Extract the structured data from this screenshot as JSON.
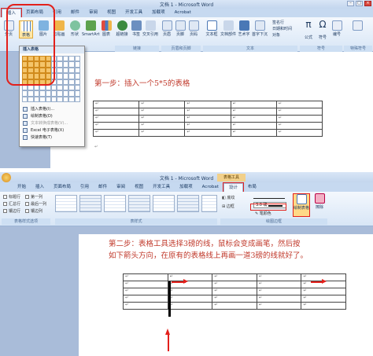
{
  "top": {
    "title": "文档 1 - Microsoft Word",
    "tabs": [
      "插入",
      "页面布局",
      "引用",
      "邮件",
      "审阅",
      "视图",
      "开发工具",
      "加载项",
      "Acrobat"
    ],
    "ribbon_buttons": [
      "分页",
      "表格",
      "图片",
      "剪贴画",
      "形状",
      "SmartArt",
      "图表",
      "超链接",
      "书签",
      "交叉引用",
      "页眉",
      "页脚",
      "页码",
      "文本框",
      "文档部件",
      "艺术字",
      "首字下沉",
      "公式",
      "符号",
      "编号"
    ],
    "side_buttons": [
      "签名行",
      "日期和时间",
      "对象"
    ],
    "groups": [
      "链接",
      "页眉和页脚",
      "文本",
      "符号",
      "特殊符号"
    ],
    "insert_table_header": "插入表格",
    "menu": [
      {
        "label": "插入表格(I)...",
        "enabled": true
      },
      {
        "label": "绘制表格(D)",
        "enabled": true
      },
      {
        "label": "文本转换成表格(V)...",
        "enabled": false
      },
      {
        "label": "Excel 电子表格(X)",
        "enabled": true
      },
      {
        "label": "快速表格(T)",
        "enabled": true
      }
    ],
    "grid": {
      "cols": 10,
      "rows": 8,
      "selected_cols": 5,
      "selected_rows": 5
    },
    "heading": "第一步：插入一个5*5的表格",
    "cell_mark": "↵"
  },
  "bottom": {
    "title": "文档 1 - Microsoft Word",
    "context_tab": "表格工具",
    "tabs": [
      "开始",
      "插入",
      "页面布局",
      "引用",
      "邮件",
      "审阅",
      "视图",
      "开发工具",
      "加载项",
      "Acrobat",
      "设计",
      "布局"
    ],
    "checks": [
      "标题行",
      "第一列",
      "汇总行",
      "最后一列",
      "镶边行",
      "镶边列"
    ],
    "group_left": "表格样式选项",
    "group_mid": "表样式",
    "group_right": "绘图边框",
    "shading": "底纹",
    "borders": "边框",
    "pen_weight": "3.0 磅",
    "pen_color": "笔颜色",
    "draw_table": "绘制表格",
    "eraser": "擦除",
    "heading_l1": "第二步：表格工具选择3磅的线，鼠标会变成画笔，然后按",
    "heading_l2": "如下箭头方向，在原有的表格线上再画一道3磅的线就好了。",
    "cell_mark": "↵"
  },
  "colors": {
    "accent_red": "#e3201b",
    "heading_red": "#c0392b"
  }
}
